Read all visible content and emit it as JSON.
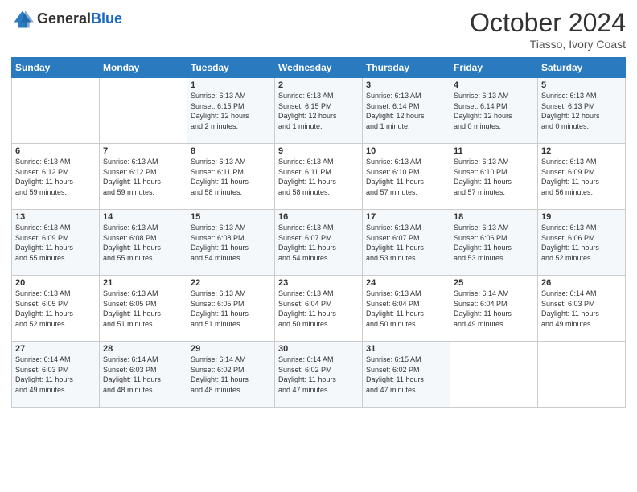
{
  "header": {
    "logo_general": "General",
    "logo_blue": "Blue",
    "month_title": "October 2024",
    "subtitle": "Tiasso, Ivory Coast"
  },
  "days_of_week": [
    "Sunday",
    "Monday",
    "Tuesday",
    "Wednesday",
    "Thursday",
    "Friday",
    "Saturday"
  ],
  "weeks": [
    [
      {
        "day": "",
        "info": ""
      },
      {
        "day": "",
        "info": ""
      },
      {
        "day": "1",
        "info": "Sunrise: 6:13 AM\nSunset: 6:15 PM\nDaylight: 12 hours\nand 2 minutes."
      },
      {
        "day": "2",
        "info": "Sunrise: 6:13 AM\nSunset: 6:15 PM\nDaylight: 12 hours\nand 1 minute."
      },
      {
        "day": "3",
        "info": "Sunrise: 6:13 AM\nSunset: 6:14 PM\nDaylight: 12 hours\nand 1 minute."
      },
      {
        "day": "4",
        "info": "Sunrise: 6:13 AM\nSunset: 6:14 PM\nDaylight: 12 hours\nand 0 minutes."
      },
      {
        "day": "5",
        "info": "Sunrise: 6:13 AM\nSunset: 6:13 PM\nDaylight: 12 hours\nand 0 minutes."
      }
    ],
    [
      {
        "day": "6",
        "info": "Sunrise: 6:13 AM\nSunset: 6:12 PM\nDaylight: 11 hours\nand 59 minutes."
      },
      {
        "day": "7",
        "info": "Sunrise: 6:13 AM\nSunset: 6:12 PM\nDaylight: 11 hours\nand 59 minutes."
      },
      {
        "day": "8",
        "info": "Sunrise: 6:13 AM\nSunset: 6:11 PM\nDaylight: 11 hours\nand 58 minutes."
      },
      {
        "day": "9",
        "info": "Sunrise: 6:13 AM\nSunset: 6:11 PM\nDaylight: 11 hours\nand 58 minutes."
      },
      {
        "day": "10",
        "info": "Sunrise: 6:13 AM\nSunset: 6:10 PM\nDaylight: 11 hours\nand 57 minutes."
      },
      {
        "day": "11",
        "info": "Sunrise: 6:13 AM\nSunset: 6:10 PM\nDaylight: 11 hours\nand 57 minutes."
      },
      {
        "day": "12",
        "info": "Sunrise: 6:13 AM\nSunset: 6:09 PM\nDaylight: 11 hours\nand 56 minutes."
      }
    ],
    [
      {
        "day": "13",
        "info": "Sunrise: 6:13 AM\nSunset: 6:09 PM\nDaylight: 11 hours\nand 55 minutes."
      },
      {
        "day": "14",
        "info": "Sunrise: 6:13 AM\nSunset: 6:08 PM\nDaylight: 11 hours\nand 55 minutes."
      },
      {
        "day": "15",
        "info": "Sunrise: 6:13 AM\nSunset: 6:08 PM\nDaylight: 11 hours\nand 54 minutes."
      },
      {
        "day": "16",
        "info": "Sunrise: 6:13 AM\nSunset: 6:07 PM\nDaylight: 11 hours\nand 54 minutes."
      },
      {
        "day": "17",
        "info": "Sunrise: 6:13 AM\nSunset: 6:07 PM\nDaylight: 11 hours\nand 53 minutes."
      },
      {
        "day": "18",
        "info": "Sunrise: 6:13 AM\nSunset: 6:06 PM\nDaylight: 11 hours\nand 53 minutes."
      },
      {
        "day": "19",
        "info": "Sunrise: 6:13 AM\nSunset: 6:06 PM\nDaylight: 11 hours\nand 52 minutes."
      }
    ],
    [
      {
        "day": "20",
        "info": "Sunrise: 6:13 AM\nSunset: 6:05 PM\nDaylight: 11 hours\nand 52 minutes."
      },
      {
        "day": "21",
        "info": "Sunrise: 6:13 AM\nSunset: 6:05 PM\nDaylight: 11 hours\nand 51 minutes."
      },
      {
        "day": "22",
        "info": "Sunrise: 6:13 AM\nSunset: 6:05 PM\nDaylight: 11 hours\nand 51 minutes."
      },
      {
        "day": "23",
        "info": "Sunrise: 6:13 AM\nSunset: 6:04 PM\nDaylight: 11 hours\nand 50 minutes."
      },
      {
        "day": "24",
        "info": "Sunrise: 6:13 AM\nSunset: 6:04 PM\nDaylight: 11 hours\nand 50 minutes."
      },
      {
        "day": "25",
        "info": "Sunrise: 6:14 AM\nSunset: 6:04 PM\nDaylight: 11 hours\nand 49 minutes."
      },
      {
        "day": "26",
        "info": "Sunrise: 6:14 AM\nSunset: 6:03 PM\nDaylight: 11 hours\nand 49 minutes."
      }
    ],
    [
      {
        "day": "27",
        "info": "Sunrise: 6:14 AM\nSunset: 6:03 PM\nDaylight: 11 hours\nand 49 minutes."
      },
      {
        "day": "28",
        "info": "Sunrise: 6:14 AM\nSunset: 6:03 PM\nDaylight: 11 hours\nand 48 minutes."
      },
      {
        "day": "29",
        "info": "Sunrise: 6:14 AM\nSunset: 6:02 PM\nDaylight: 11 hours\nand 48 minutes."
      },
      {
        "day": "30",
        "info": "Sunrise: 6:14 AM\nSunset: 6:02 PM\nDaylight: 11 hours\nand 47 minutes."
      },
      {
        "day": "31",
        "info": "Sunrise: 6:15 AM\nSunset: 6:02 PM\nDaylight: 11 hours\nand 47 minutes."
      },
      {
        "day": "",
        "info": ""
      },
      {
        "day": "",
        "info": ""
      }
    ]
  ]
}
